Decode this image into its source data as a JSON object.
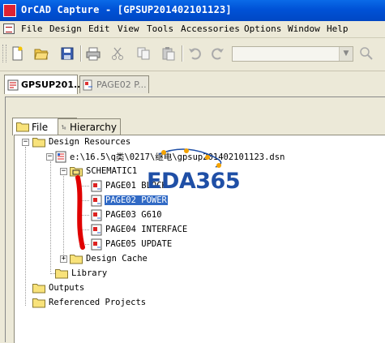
{
  "window": {
    "title": "OrCAD Capture - [GPSUP201402101123]"
  },
  "menu": {
    "items": [
      "File",
      "Design",
      "Edit",
      "View",
      "Tools",
      "Accessories",
      "Options",
      "Window",
      "Help"
    ]
  },
  "toolbar": {
    "icons": [
      "new-icon",
      "open-icon",
      "save-icon",
      "print-icon",
      "cut-icon",
      "copy-icon",
      "paste-icon",
      "undo-icon",
      "redo-icon"
    ],
    "combo_value": ""
  },
  "doc_tabs": [
    {
      "label": "GPSUP201..*",
      "active": true
    },
    {
      "label": "PAGE02 P...",
      "active": false
    }
  ],
  "panel_tabs": [
    {
      "label": "File",
      "active": true
    },
    {
      "label": "Hierarchy",
      "active": false
    }
  ],
  "tree": {
    "design_resources": "Design Resources",
    "dsn_file": "e:\\16.5\\q类\\0217\\继电\\gpsup201402101123.dsn",
    "schematic": "SCHEMATIC1",
    "pages": [
      "PAGE01 BLOCK",
      "PAGE02 POWER",
      "PAGE03 G610",
      "PAGE04 INTERFACE",
      "PAGE05 UPDATE"
    ],
    "selected_page_index": 1,
    "design_cache": "Design Cache",
    "library": "Library",
    "outputs": "Outputs",
    "referenced_projects": "Referenced Projects"
  },
  "watermark": "EDA365",
  "colors": {
    "titlebar": "#0054e3",
    "selection": "#316ac5",
    "annotation_red": "#e00000",
    "watermark": "#1f4fa6"
  }
}
